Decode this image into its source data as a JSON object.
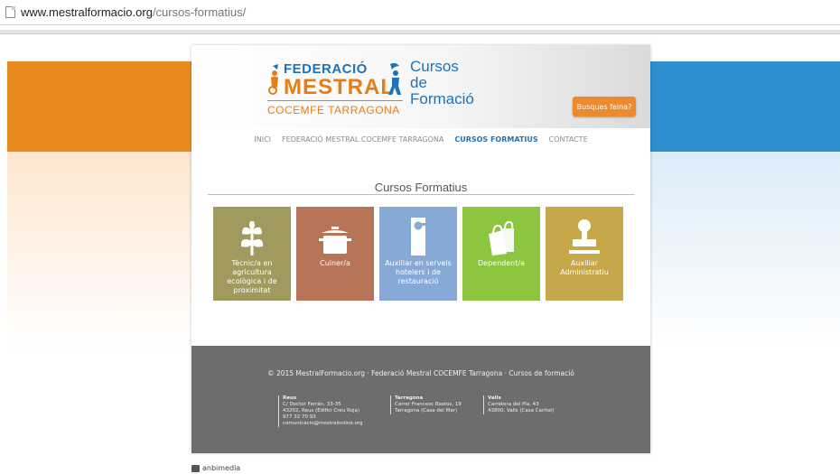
{
  "browser": {
    "url_domain": "www.mestralformacio.org",
    "url_path": "/cursos-formatius/"
  },
  "header": {
    "logo_top": "FEDERACIÓ",
    "logo_main": "MESTRAL",
    "logo_sub": "COCEMFE TARRAGONA",
    "cursos_line1": "Cursos",
    "cursos_line2": "de Formació",
    "jobs_button": "Busques feina?"
  },
  "nav": {
    "items": [
      "INICI",
      "FEDERACIÓ MESTRAL COCEMFE TARRAGONA",
      "CURSOS FORMATIUS",
      "CONTACTE"
    ],
    "active": "CURSOS FORMATIUS"
  },
  "section": {
    "title": "Cursos Formatius"
  },
  "courses": [
    {
      "label": "Tècnic/a en agricultura ecològica i de proximitat",
      "icon": "plant-icon",
      "color": "#a09a5e"
    },
    {
      "label": "Cuiner/a",
      "icon": "cooking-pot-icon",
      "color": "#b87457"
    },
    {
      "label": "Auxiliar en serveis hotelers i de restauració",
      "icon": "door-hanger-icon",
      "color": "#86a9d6"
    },
    {
      "label": "Dependent/a",
      "icon": "shopping-bag-icon",
      "color": "#8cc63f"
    },
    {
      "label": "Auxiliar Administratiu",
      "icon": "stamp-icon",
      "color": "#c6a84a"
    }
  ],
  "footer": {
    "copyright": "© 2015 MestralFormacio.org · Federació Mestral COCEMFE Tarragona · Cursos de formació",
    "offices": [
      {
        "city": "Reus",
        "lines": [
          "C/ Doctor Ferrán, 33-35",
          "43202, Reus (Edifici Creu Roja)",
          "977 32 70 93",
          "comunicacio@mestralonline.org"
        ]
      },
      {
        "city": "Tarragona",
        "lines": [
          "Carrer Francesc Bastos, 19",
          "Tarragona (Casa del Mar)"
        ]
      },
      {
        "city": "Valls",
        "lines": [
          "Carretera del Pla, 43",
          "43800, Valls (Casa Caritat)"
        ]
      }
    ]
  },
  "credit": "anbimedia",
  "colors": {
    "orange": "#ea8a1e",
    "blue": "#2e8fd0",
    "footer": "#6d6d6d"
  }
}
